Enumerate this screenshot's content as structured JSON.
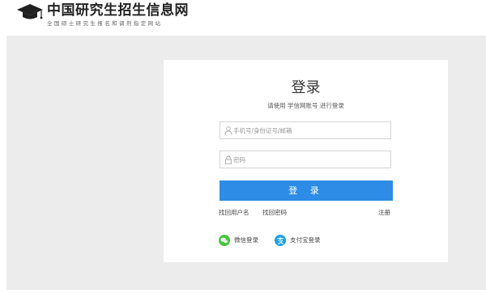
{
  "header": {
    "site_title": "中国研究生招生信息网",
    "site_subtitle": "全国硕士研究生报名和调剂指定网站",
    "logo_icon": "graduation-cap-icon"
  },
  "login": {
    "title": "登录",
    "subtitle": "请使用 学信网账号 进行登录",
    "username_placeholder": "手机号/身份证号/邮箱",
    "username_icon": "user-icon",
    "password_placeholder": "密码",
    "password_icon": "lock-icon",
    "submit_label": "登 录",
    "find_username_link": "找回用户名",
    "find_password_link": "找回密码",
    "register_link": "注册",
    "wechat_label": "微信登录",
    "wechat_icon": "wechat-icon",
    "alipay_label": "支付宝登录",
    "alipay_icon": "alipay-icon"
  },
  "colors": {
    "primary_button": "#2d8ce6",
    "page_background": "#ececec",
    "wechat_green": "#48c43e",
    "alipay_blue": "#1ba1e2"
  }
}
